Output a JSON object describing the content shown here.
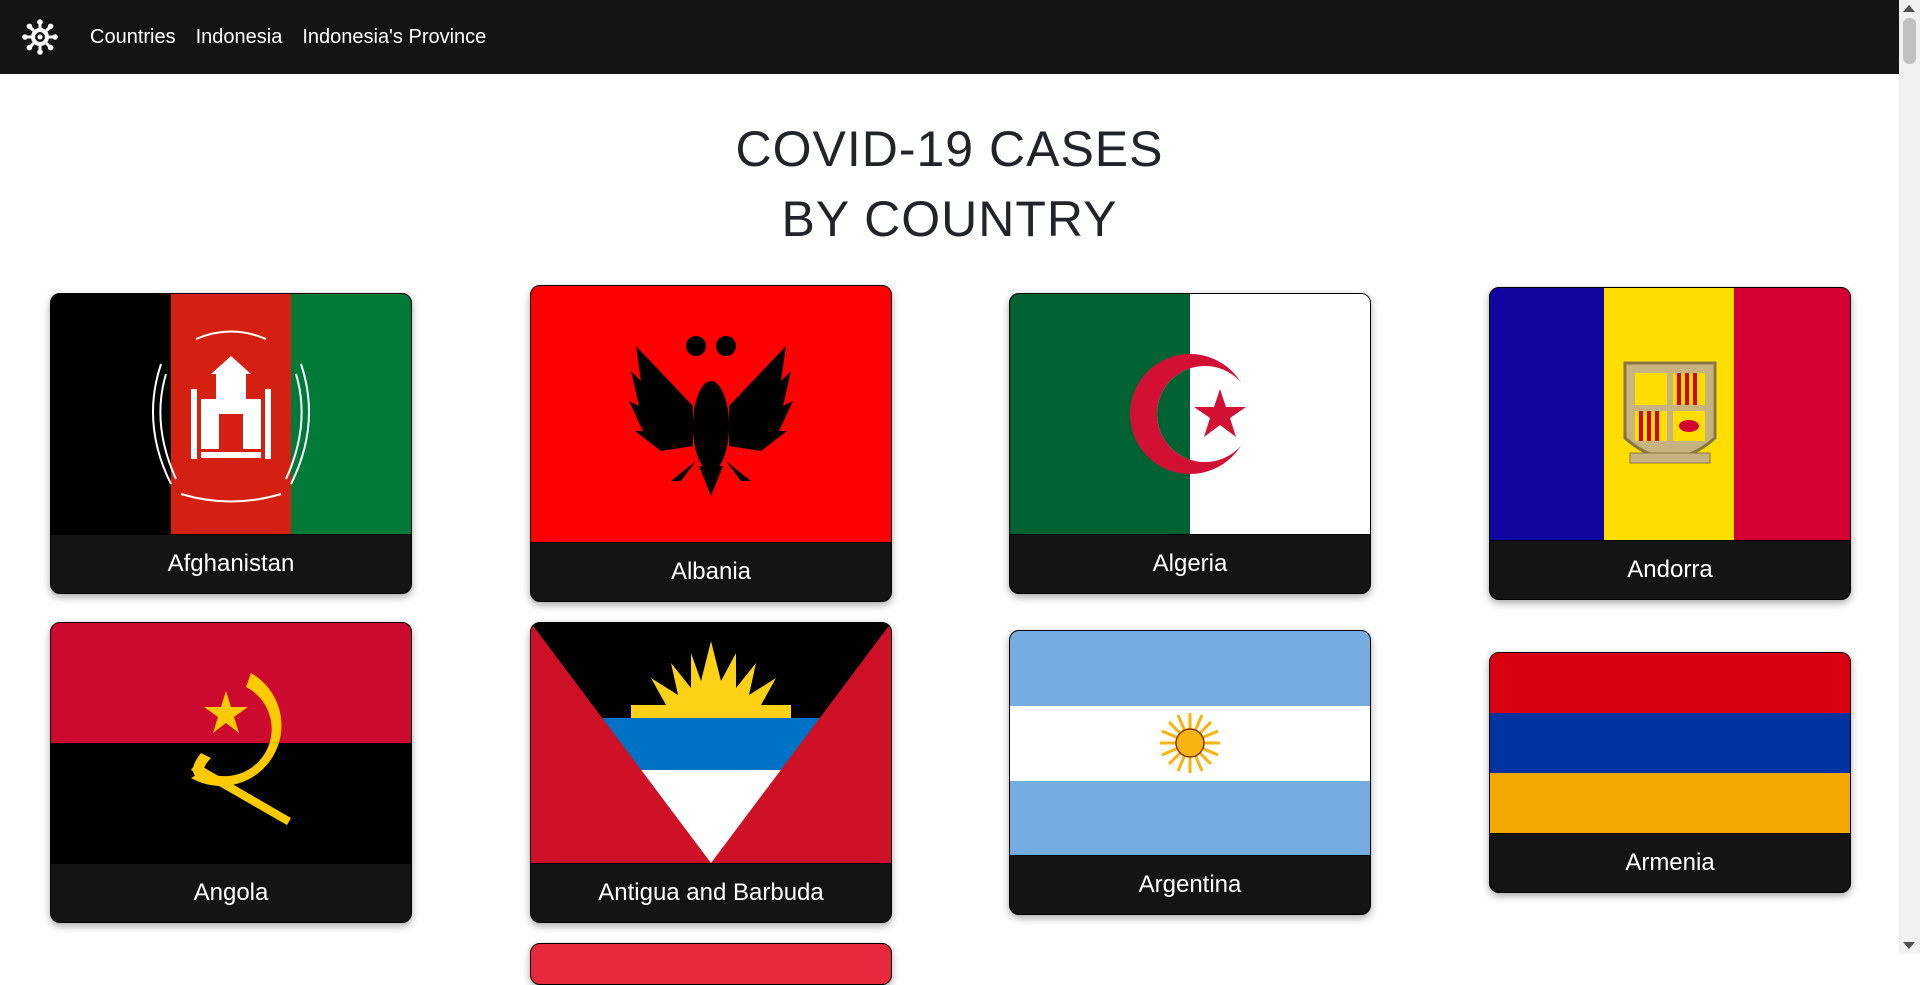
{
  "nav": {
    "links": [
      "Countries",
      "Indonesia",
      "Indonesia's Province"
    ]
  },
  "page": {
    "title_line1": "COVID-19 CASES",
    "title_line2": "BY COUNTRY"
  },
  "countries": [
    "Afghanistan",
    "Albania",
    "Algeria",
    "Andorra",
    "Angola",
    "Antigua and Barbuda",
    "Argentina",
    "Armenia"
  ],
  "colors": {
    "navbar": "#141414",
    "card_label_bg": "#141414",
    "title": "#212529"
  }
}
